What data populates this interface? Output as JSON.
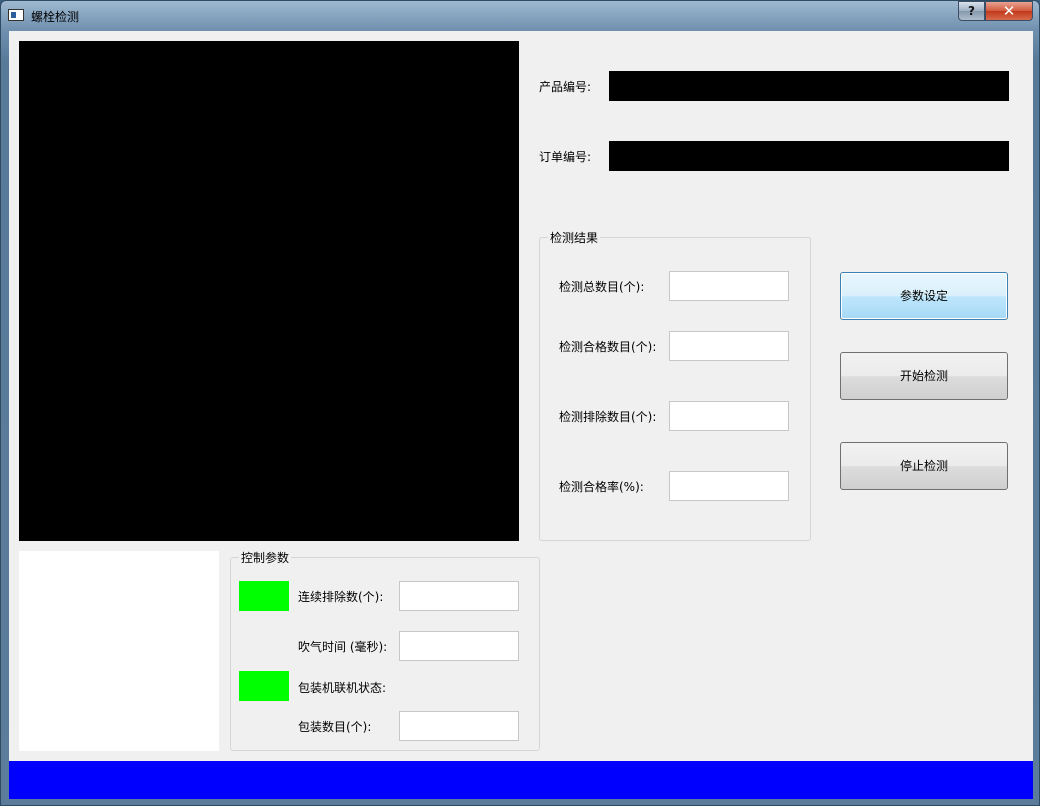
{
  "window": {
    "title": "螺栓检测",
    "help_label": "?",
    "close_label": "✕"
  },
  "colors": {
    "indicator": "#00ff00",
    "statusbar": "#0000ff",
    "video_background": "#000000"
  },
  "product": {
    "product_no_label": "产品编号:",
    "order_no_label": "订单编号:"
  },
  "results": {
    "group_title": "检测结果",
    "total_label": "检测总数目(个):",
    "pass_label": "检测合格数目(个):",
    "reject_label": "检测排除数目(个):",
    "rate_label": "检测合格率(%):"
  },
  "buttons": {
    "settings": "参数设定",
    "start": "开始检测",
    "stop": "停止检测"
  },
  "control": {
    "group_title": "控制参数",
    "consecutive_reject_label": "连续排除数(个):",
    "blow_time_label": "吹气时间 (毫秒):",
    "packer_status_label": "包装机联机状态:",
    "package_count_label": "包装数目(个):"
  }
}
